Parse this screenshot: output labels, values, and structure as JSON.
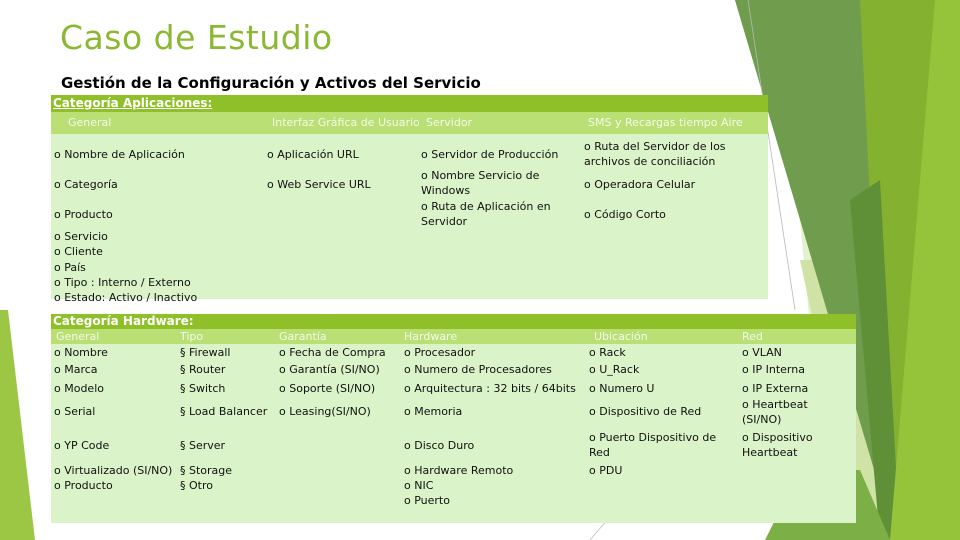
{
  "slide": {
    "title": "Caso de Estudio",
    "subtitle": "Gestión de la Configuración y Activos del Servicio"
  },
  "colors": {
    "title": "#8ab833",
    "category_bar": "#8fc02a",
    "subheader_bar": "#b9df75",
    "body": "#dbf3c9"
  },
  "applications": {
    "category_label": "Categoría Aplicaciones:",
    "columns": [
      {
        "header": "General",
        "items": [
          "o Nombre de Aplicación",
          "o Categoría",
          "o Producto",
          "o Servicio",
          "o Cliente",
          "o País",
          "o Tipo : Interno / Externo",
          "o Estado: Activo / Inactivo"
        ]
      },
      {
        "header": "Interfaz Gráfica de Usuario",
        "items": [
          "o Aplicación URL",
          "o Web Service URL"
        ]
      },
      {
        "header": "Servidor",
        "items": [
          "o Servidor de Producción",
          "o Nombre Servicio de Windows",
          "o Ruta de Aplicación en Servidor"
        ]
      },
      {
        "header": "SMS y Recargas tiempo Aire",
        "items": [
          "o Ruta del Servidor de los archivos de conciliación",
          "o Operadora Celular",
          "o Código Corto"
        ]
      }
    ]
  },
  "hardware": {
    "category_label": "Categoría Hardware:",
    "columns": [
      {
        "header": "General",
        "bullet": "o",
        "items": [
          "Nombre",
          "Marca",
          "Modelo",
          "Serial",
          "YP Code",
          "Virtualizado (SI/NO)",
          "Producto"
        ]
      },
      {
        "header": "Tipo",
        "bullet": "§",
        "items": [
          "Firewall",
          "Router",
          "Switch",
          "Load Balancer",
          "Server",
          "Storage",
          "Otro"
        ]
      },
      {
        "header": "Garantía",
        "bullet": "o",
        "items": [
          "Fecha de Compra",
          "Garantía (SI/NO)",
          "Soporte (SI/NO)",
          "Leasing(SI/NO)"
        ]
      },
      {
        "header": "Hardware",
        "bullet": "o",
        "items": [
          "Procesador",
          "Numero de Procesadores",
          "Arquitectura : 32 bits / 64bits",
          "Memoria",
          "Disco Duro",
          "Hardware Remoto",
          "NIC",
          "Puerto"
        ]
      },
      {
        "header": "Ubicación",
        "bullet": "o",
        "items": [
          "Rack",
          "U_Rack",
          "Numero U",
          "Dispositivo de Red",
          "Puerto Dispositivo de Red",
          "PDU"
        ]
      },
      {
        "header": "Red",
        "bullet": "o",
        "items": [
          "VLAN",
          "IP Interna",
          "IP Externa",
          "Heartbeat (SI/NO)",
          "Dispositivo Heartbeat"
        ]
      }
    ]
  }
}
